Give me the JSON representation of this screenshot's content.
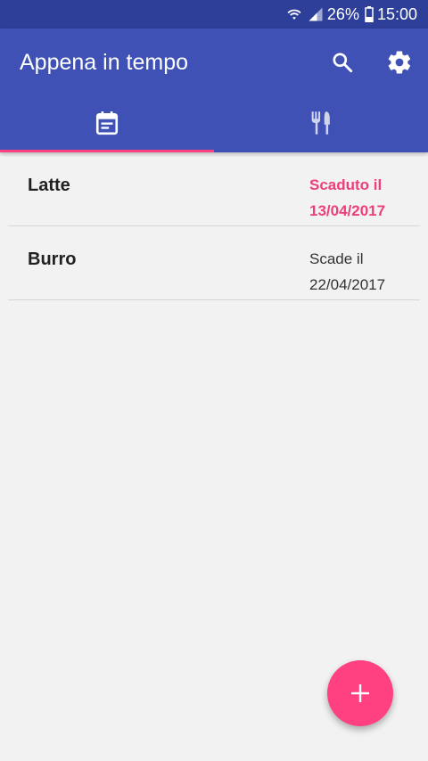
{
  "status_bar": {
    "battery": "26%",
    "time": "15:00",
    "icons": [
      "wifi-icon",
      "signal-icon",
      "battery-icon"
    ]
  },
  "app_bar": {
    "title": "Appena in tempo",
    "actions": [
      "search-icon",
      "gear-icon"
    ]
  },
  "tabs": [
    {
      "icon": "calendar-icon",
      "selected": true
    },
    {
      "icon": "fork-knife-icon",
      "selected": false
    }
  ],
  "items": [
    {
      "name": "Latte",
      "expiry_line1": "Scaduto il",
      "expiry_line2": "13/04/2017",
      "expired": true
    },
    {
      "name": "Burro",
      "expiry_line1": "Scade il",
      "expiry_line2": "22/04/2017",
      "expired": false
    }
  ],
  "fab": {
    "icon": "plus-icon"
  },
  "colors": {
    "primary": "#3f51b5",
    "primary_dark": "#2e3f9a",
    "accent": "#ff4081",
    "expired_text": "#ec407a",
    "background": "#f2f2f2"
  }
}
